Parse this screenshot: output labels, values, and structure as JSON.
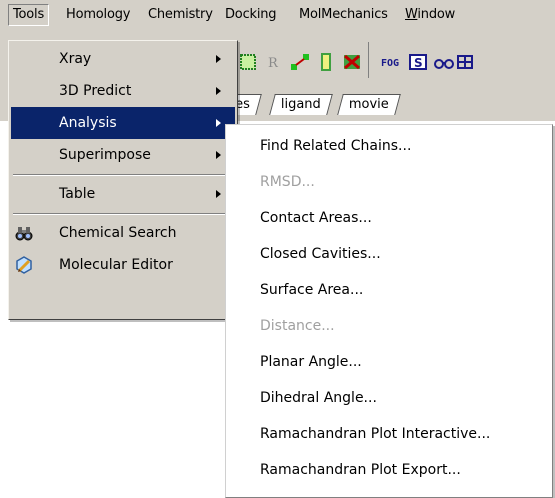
{
  "menubar": {
    "items": [
      {
        "label": "Tools"
      },
      {
        "label": "Homology"
      },
      {
        "label": "Chemistry"
      },
      {
        "label": "Docking"
      },
      {
        "label": "MolMechanics"
      },
      {
        "label": "Window"
      }
    ]
  },
  "background": {
    "tabs": [
      "nes",
      "ligand",
      "movie"
    ]
  },
  "tools_menu": {
    "items": [
      {
        "label": "Xray",
        "submenu": true
      },
      {
        "label": "3D Predict",
        "submenu": true
      },
      {
        "label": "Analysis",
        "submenu": true,
        "highlighted": true
      },
      {
        "label": "Superimpose",
        "submenu": true
      },
      {
        "label": "Table",
        "submenu": true
      },
      {
        "label": "Chemical Search",
        "icon": "binoculars-icon"
      },
      {
        "label": "Molecular Editor",
        "icon": "pencil-molecule-icon"
      }
    ]
  },
  "analysis_menu": {
    "items": [
      {
        "label": "Find Related Chains...",
        "enabled": true
      },
      {
        "label": "RMSD...",
        "enabled": false
      },
      {
        "label": "Contact Areas...",
        "enabled": true
      },
      {
        "label": "Closed Cavities...",
        "enabled": true
      },
      {
        "label": "Surface Area...",
        "enabled": true
      },
      {
        "label": "Distance...",
        "enabled": false
      },
      {
        "label": "Planar Angle...",
        "enabled": true
      },
      {
        "label": "Dihedral Angle...",
        "enabled": true
      },
      {
        "label": "Ramachandran Plot Interactive...",
        "enabled": true
      },
      {
        "label": "Ramachandran Plot Export...",
        "enabled": true
      }
    ]
  },
  "colors": {
    "highlight": "#0a246a",
    "menu_bg": "#d4d0c8",
    "disabled_text": "#a0a0a0"
  }
}
